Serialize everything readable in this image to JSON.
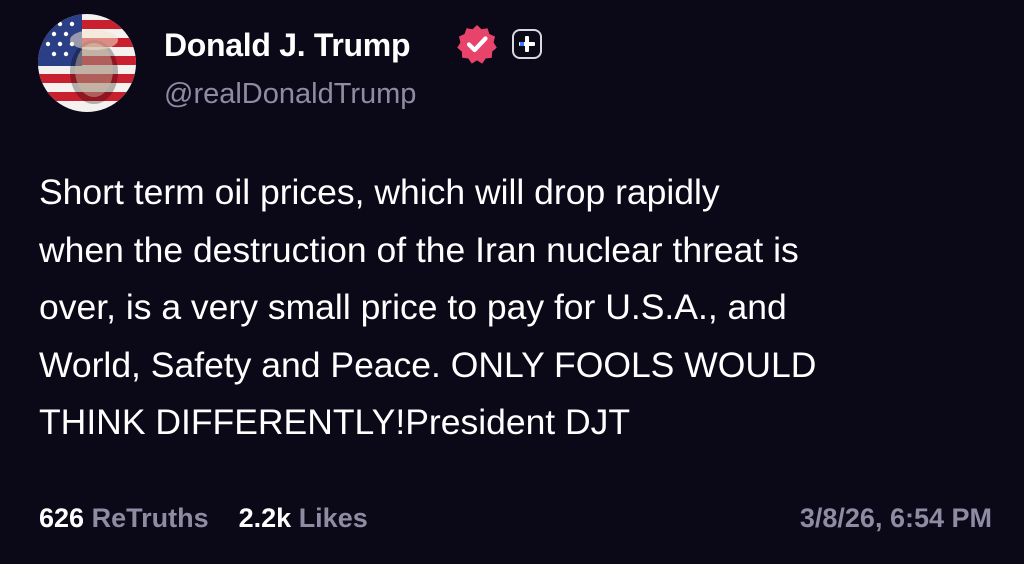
{
  "author": {
    "display_name": "Donald J. Trump",
    "handle": "@realDonaldTrump",
    "avatar_icon": "profile-avatar",
    "verified_icon": "verified-badge-icon",
    "plus_icon": "plus-badge-icon"
  },
  "post": {
    "lines": [
      "Short term oil prices, which will drop rapidly",
      "when the destruction of the Iran nuclear threat is",
      "over, is a very small price to pay for U.S.A., and",
      "World, Safety and Peace. ONLY FOOLS WOULD",
      "THINK DIFFERENTLY!President DJT"
    ]
  },
  "stats": {
    "retruths_count": "626",
    "retruths_label": "ReTruths",
    "likes_count": "2.2k",
    "likes_label": "Likes"
  },
  "timestamp": "3/8/26, 6:54 PM",
  "colors": {
    "background": "#0b0918",
    "text": "#ffffff",
    "muted": "#8f8ba3",
    "verified": "#e8446b"
  }
}
